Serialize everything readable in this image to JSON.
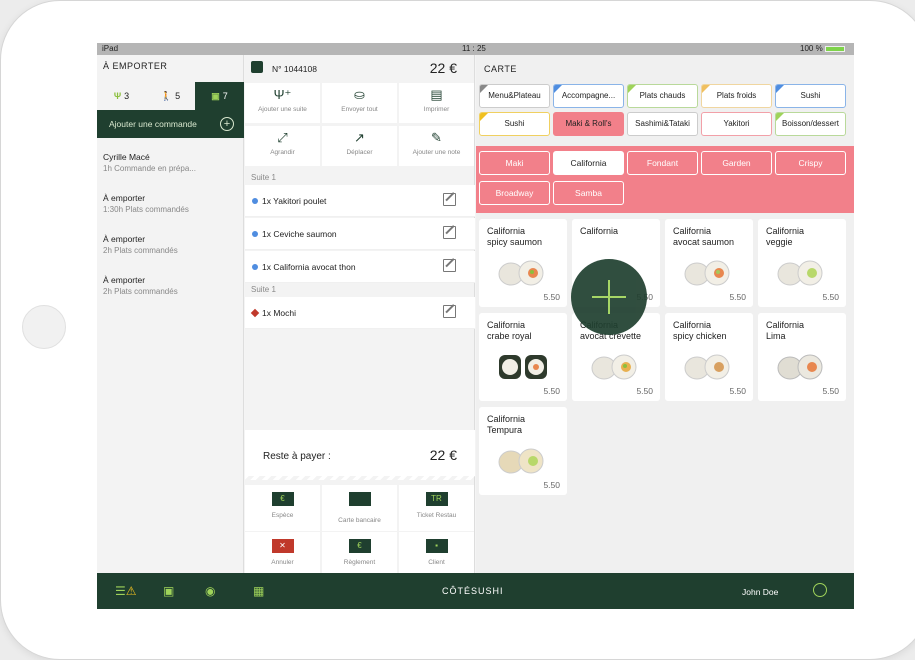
{
  "statusbar": {
    "device": "iPad",
    "time": "11 : 25",
    "battery": "100 %"
  },
  "left": {
    "title": "À EMPORTER",
    "tabs": [
      {
        "icon": "fork-knife-icon",
        "count": "3"
      },
      {
        "icon": "walker-icon",
        "count": "5"
      },
      {
        "icon": "bag-icon",
        "count": "7"
      }
    ],
    "add_order": "Ajouter une commande",
    "orders": [
      {
        "name": "Cyrille Macé",
        "status": "1h Commande en prépa..."
      },
      {
        "name": "À emporter",
        "status": "1:30h Plats commandés"
      },
      {
        "name": "À emporter",
        "status": "2h Plats commandés"
      },
      {
        "name": "À emporter",
        "status": "2h Plats commandés"
      }
    ]
  },
  "order": {
    "number": "N° 1044108",
    "total": "22 €",
    "actions": [
      "Ajouter une suite",
      "Envoyer tout",
      "Imprimer",
      "Agrandir",
      "Déplacer",
      "Ajouter une note"
    ],
    "suite1": "Suite 1",
    "items1": [
      "1x Yakitori poulet",
      "1x Ceviche saumon",
      "1x California avocat thon"
    ],
    "suite2": "Suite 1",
    "items2": [
      "1x Mochi"
    ],
    "pay_label": "Reste à payer :",
    "pay_value": "22 €",
    "pay_actions": [
      {
        "label": "Espèce",
        "icon": "€"
      },
      {
        "label": "Carte bancaire",
        "icon": ""
      },
      {
        "label": "Ticket Restau",
        "icon": "TR"
      },
      {
        "label": "Annuler",
        "icon": "✕"
      },
      {
        "label": "Règlement",
        "icon": "€"
      },
      {
        "label": "Client",
        "icon": "▪"
      }
    ]
  },
  "menu": {
    "title": "CARTE",
    "categories_row1": [
      "Menu&Plateau",
      "Accompagne...",
      "Plats chauds",
      "Plats froids",
      "Sushi"
    ],
    "categories_row2": [
      "Sushi",
      "Maki & Roll's",
      "Sashimi&Tataki",
      "Yakitori",
      "Boisson/dessert"
    ],
    "subcategories": [
      "Maki",
      "California",
      "Fondant",
      "Garden",
      "Crispy",
      "Broadway",
      "Samba"
    ],
    "products": [
      {
        "name1": "California",
        "name2": "spicy saumon",
        "price": "5.50"
      },
      {
        "name1": "California",
        "name2": "avocat saumon",
        "price": "5.50"
      },
      {
        "name1": "California",
        "name2": "veggie",
        "price": "5.50"
      },
      {
        "name1": "California",
        "name2": "crabe royal",
        "price": "5.50"
      },
      {
        "name1": "California",
        "name2": "avocat crevette",
        "price": "5.50"
      },
      {
        "name1": "California",
        "name2": "spicy chicken",
        "price": "5.50"
      },
      {
        "name1": "California",
        "name2": "Lima",
        "price": "5.50"
      },
      {
        "name1": "California",
        "name2": "Tempura",
        "price": "5.50"
      }
    ],
    "partial_card": {
      "name1": "California",
      "price": "5.50"
    }
  },
  "bottom": {
    "brand": "CÔTÉSUSHI",
    "user": "John Doe"
  }
}
